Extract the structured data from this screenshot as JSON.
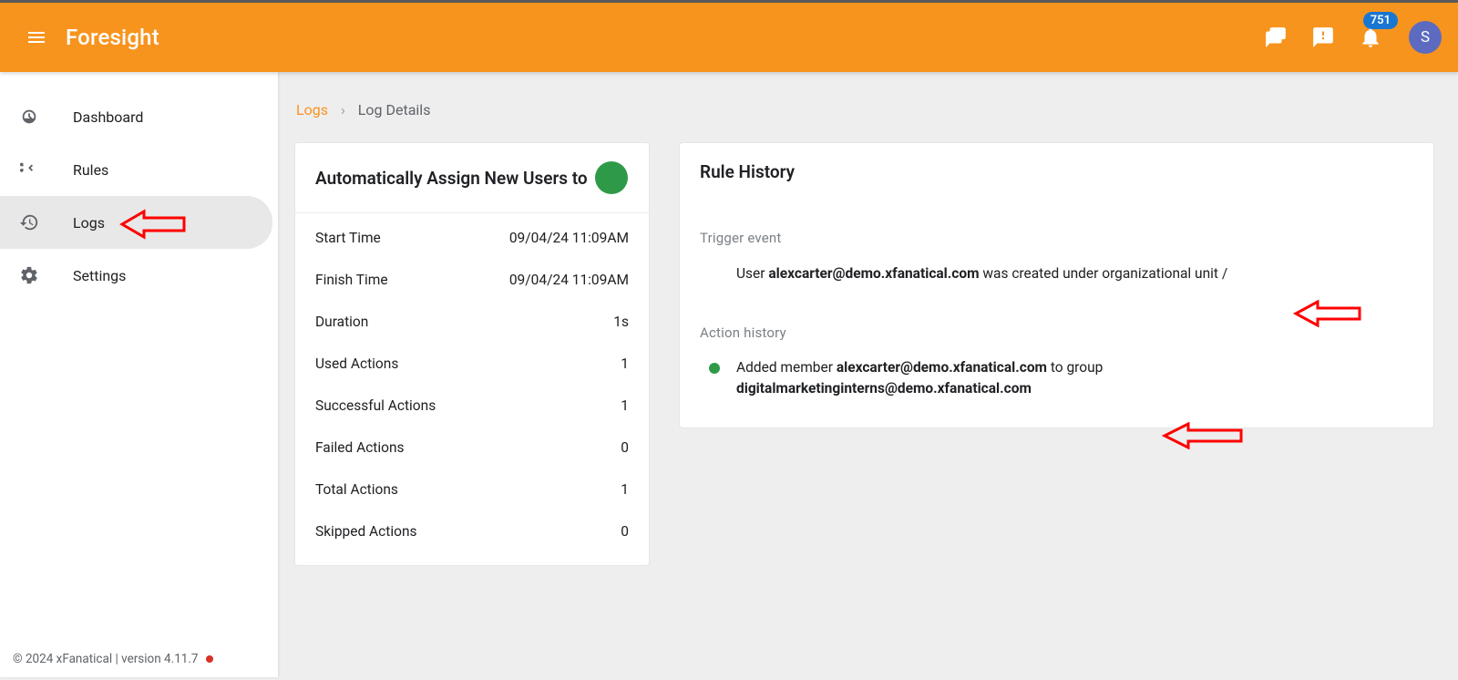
{
  "header": {
    "app_title": "Foresight",
    "notification_count": "751",
    "avatar_initial": "S"
  },
  "sidebar": {
    "items": [
      {
        "label": "Dashboard"
      },
      {
        "label": "Rules"
      },
      {
        "label": "Logs"
      },
      {
        "label": "Settings"
      }
    ],
    "footer": "© 2024 xFanatical | version 4.11.7"
  },
  "breadcrumb": {
    "root": "Logs",
    "current": "Log Details"
  },
  "summary": {
    "title": "Automatically Assign New Users to",
    "rows": [
      {
        "k": "Start Time",
        "v": "09/04/24 11:09AM"
      },
      {
        "k": "Finish Time",
        "v": "09/04/24 11:09AM"
      },
      {
        "k": "Duration",
        "v": "1s"
      },
      {
        "k": "Used Actions",
        "v": "1"
      },
      {
        "k": "Successful Actions",
        "v": "1"
      },
      {
        "k": "Failed Actions",
        "v": "0"
      },
      {
        "k": "Total Actions",
        "v": "1"
      },
      {
        "k": "Skipped Actions",
        "v": "0"
      }
    ]
  },
  "history": {
    "title": "Rule History",
    "trigger_label": "Trigger event",
    "trigger_prefix": "User ",
    "trigger_email": "alexcarter@demo.xfanatical.com",
    "trigger_suffix": " was created under organizational unit /",
    "action_label": "Action history",
    "action_prefix": "Added member ",
    "action_email1": "alexcarter@demo.xfanatical.com",
    "action_mid": " to group ",
    "action_email2": "digitalmarketinginterns@demo.xfanatical.com"
  }
}
